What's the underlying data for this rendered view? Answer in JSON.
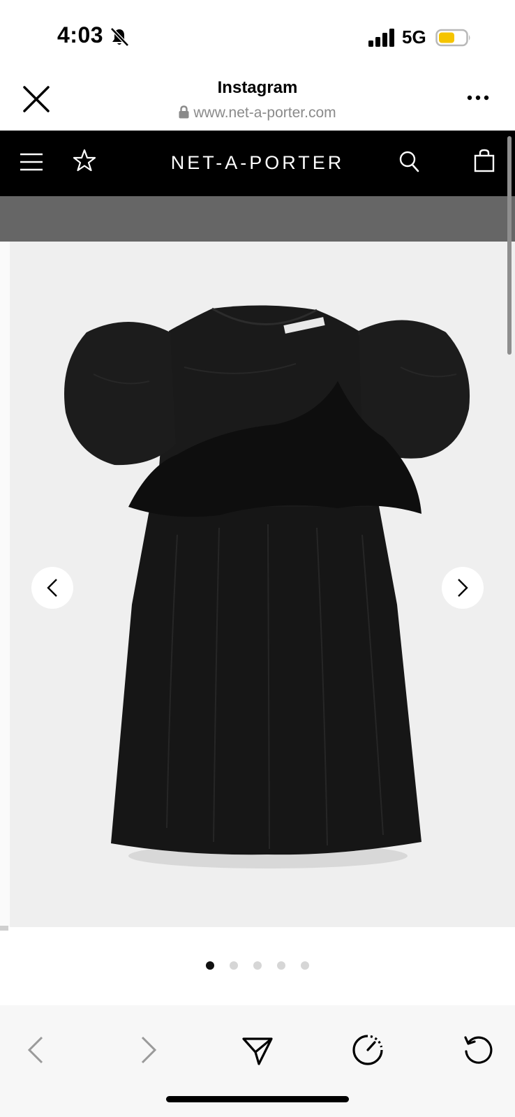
{
  "status_bar": {
    "time": "4:03",
    "network": "5G",
    "icons": [
      "bell-slash-icon",
      "signal-icon",
      "battery-icon"
    ],
    "battery_color": "#f5c400"
  },
  "browser": {
    "title": "Instagram",
    "url": "www.net-a-porter.com",
    "icons": [
      "close-icon",
      "lock-icon",
      "more-icon"
    ]
  },
  "site_nav": {
    "logo": "NET-A-PORTER",
    "icons": [
      "menu-icon",
      "star-icon",
      "search-icon",
      "bag-icon"
    ],
    "background": "#000000"
  },
  "product": {
    "image": "black-puff-sleeve-mini-dress",
    "carousel_icons": [
      "chevron-left-icon",
      "chevron-right-icon"
    ],
    "pagination": {
      "total": 5,
      "active_index": 0
    }
  },
  "toolbar": {
    "icons": [
      "back-icon",
      "forward-icon",
      "share-icon",
      "speed-icon",
      "reload-icon"
    ]
  }
}
